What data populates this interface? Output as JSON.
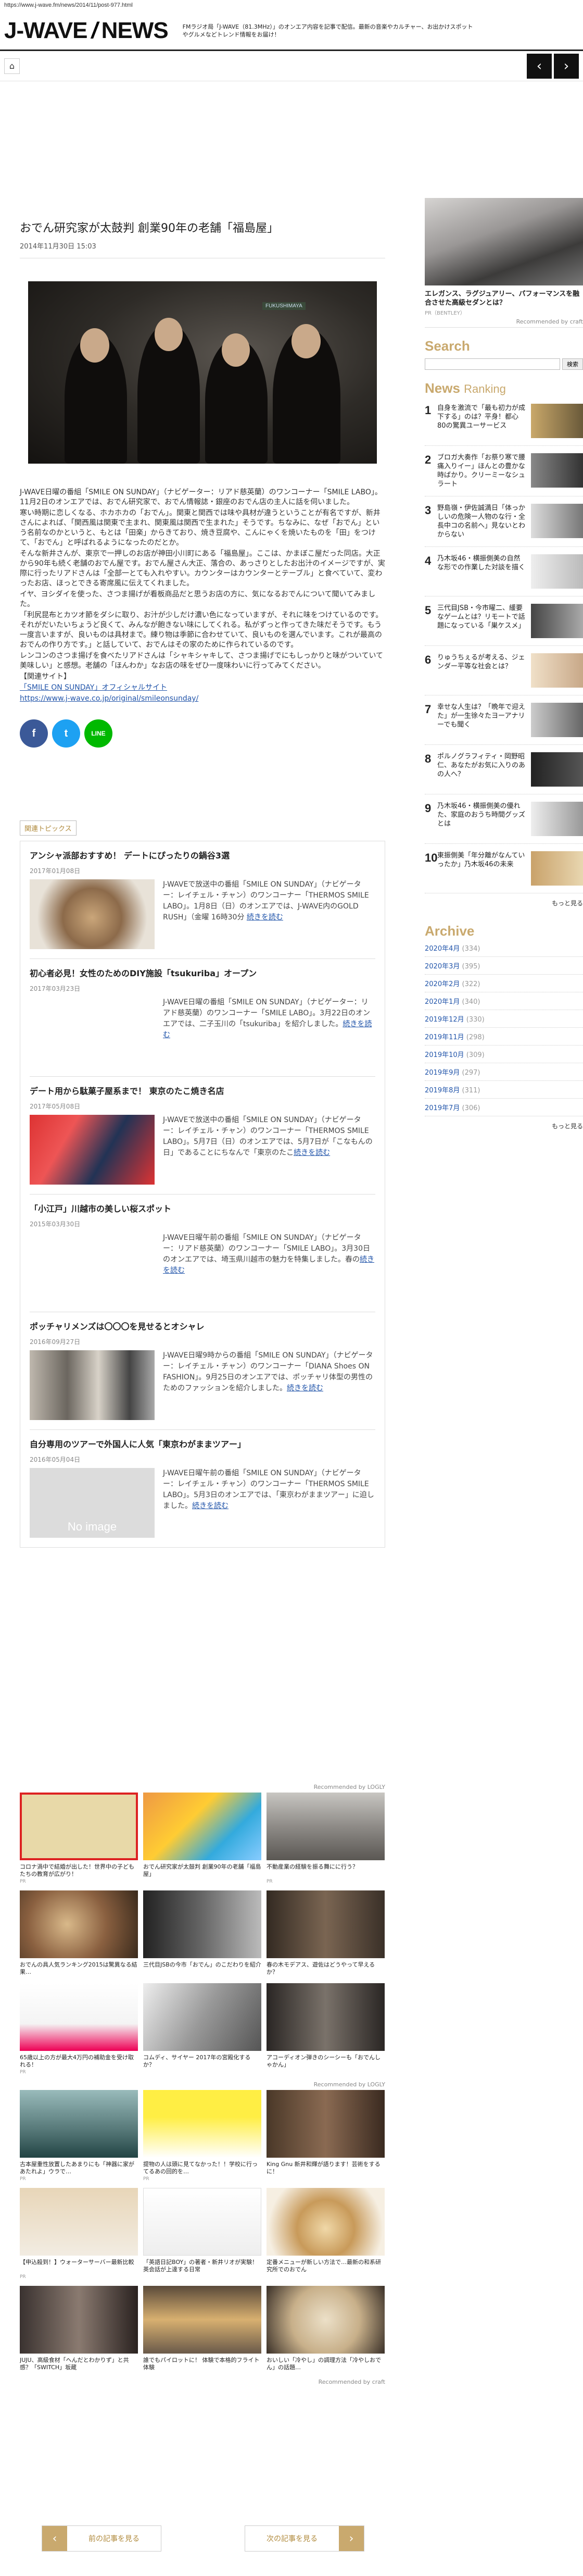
{
  "url": "https://www.j-wave.fm/news/2014/11/post-977.html",
  "logo": {
    "part1": "J-WAVE",
    "part2": "NEWS"
  },
  "tagline": "FMラジオ局「J-WAVE（81.3MHz）」のオンエア内容を記事で配信。最新の音楽やカルチャー、お出かけスポットやグルメなどトレンド情報をお届け！",
  "nav": {
    "home": "⌂",
    "prev": "‹",
    "next": "›"
  },
  "article": {
    "title": "おでん研究家が太鼓判 創業90年の老舗「福島屋」",
    "date": "2014年11月30日 15:03",
    "paragraphs": [
      "J-WAVE日曜の番組「SMILE ON SUNDAY」（ナビゲーター：リアド慈英蘭）のワンコーナー「SMILE LABO」。11月2日のオンエアでは、おでん研究家で、おでん情報誌・銀座のおでん店の主人に話を伺いました。",
      "寒い時期に恋しくなる、ホカホカの「おでん」。関東と関西では味や具材が違うということが有名ですが、新井さんによれば、「関西風は関東で主まれ、関東風は関西で生まれた」そうです。ちなみに、なぜ「おでん」という名前なのかというと、もとは「田楽」からきており、焼き豆腐や、こんにゃくを焼いたものを「田」をつけて、「おでん」と呼ばれるようになったのだとか。",
      "そんな新井さんが、東京で一押しのお店が神田小川町にある「福島屋」。ここは、かまぼこ屋だった同店。大正から90年も続く老舗のおでん屋です。おでん屋さん大正、落合の、あっさりとしたお出汁のイメージですが、実際に行ったリアドさんは「全部一とても入れやすい。カウンターはカウンターとテーブル」と食べていて、変わったお店、ほっとできる寄席風に伝えてくれました。",
      "イヤ、ヨシダイを使った、さつま揚げが看板商品だと思うお店の方に、気になるおでんについて聞いてみました。",
      "「利尻昆布とカツオ節をダシに取り、お汁が少しだけ濃い色になっていますが、それに味をつけているのです。それがだいたいちょうど良くて、みんなが飽きない味にしてくれる。私がずっと作ってきた味だそうです。もう一度言いますが、良いものは具材まで。練り物は季節に合わせていて、良いものを選んでいます。これが最高のおでんの作り方です。」と話していて、おでんはその家のために作られているのです。",
      "レンコンのさつま揚げを食べたリアドさんは「シャキシャキして、さつま揚げでにもしっかりと味がついていて美味しい」と感想。老舗の「ほんわか」なお店の味をぜひ一度味わいに行ってみてください。"
    ],
    "related_site_label": "【関連サイト】",
    "link1": "「SMILE ON SUNDAY」オフィシャルサイト",
    "link2": "https://www.j-wave.co.jp/original/smileonsunday/"
  },
  "share": {
    "facebook": "f",
    "twitter": "t",
    "line": "LINE"
  },
  "related_label": "関連トピックス",
  "related": [
    {
      "title": "アンシャ派部おすすめ！ デートにぴったりの鍋谷3選",
      "date": "2017年01月08日",
      "text": "J-WAVEで放送中の番組「SMILE ON SUNDAY」（ナビゲーター：レイチェル・チャン）のワンコーナー「THERMOS SMILE LABO」。1月8日（日）のオンエアでは、J-WAVE内のGOLD RUSH」（金曜 16時30分 ",
      "more": "続きを読む"
    },
    {
      "title": "初心者必見！女性のためのDIY施設「tsukuriba」オープン",
      "date": "2017年03月23日",
      "text": "J-WAVE日曜の番組「SMILE ON SUNDAY」（ナビゲーター：リアド慈英蘭）のワンコーナー「SMILE LABO」。3月22日のオンエアでは、二子玉川の「tsukuriba」を紹介しました。",
      "more": "続きを読む"
    },
    {
      "title": "デート用から駄菓子屋系まで！ 東京のたこ焼き名店",
      "date": "2017年05月08日",
      "text": "J-WAVEで放送中の番組「SMILE ON SUNDAY」（ナビゲーター：レイチェル・チャン）のワンコーナー「THERMOS SMILE LABO」。5月7日（日）のオンエアでは、5月7日が「こなもんの日」であることにちなんで「東京のたこ",
      "more": "続きを読む"
    },
    {
      "title": "「小江戸」川越市の美しい桜スポット",
      "date": "2015年03月30日",
      "text": "J-WAVE日曜午前の番組「SMILE ON SUNDAY」（ナビゲーター：リアド慈英蘭）のワンコーナー「SMILE LABO」。3月30日のオンエアでは、埼玉県川越市の魅力を特集しました。春の",
      "more": "続きを読む"
    },
    {
      "title": "ポッチャリメンズは〇〇〇を見せるとオシャレ",
      "date": "2016年09月27日",
      "text": "J-WAVE日曜9時からの番組「SMILE ON SUNDAY」（ナビゲーター：レイチェル・チャン）のワンコーナー「DIANA Shoes ON FASHION」。9月25日のオンエアでは、ポッチャリ体型の男性のためのファッションを紹介しました。",
      "more": "続きを読む"
    },
    {
      "title": "自分専用のツアーで外国人に人気「東京わがままツアー」",
      "date": "2016年05月04日",
      "text": "J-WAVE日曜午前の番組「SMILE ON SUNDAY」（ナビゲーター：レイチェル・チャン）のワンコーナー「THERMOS SMILE LABO」。5月3日のオンエアでは、「東京わがままツアー」に迫しました。",
      "more": "続きを読む"
    }
  ],
  "noimage": "No image",
  "ads": {
    "label1": "Recommended by LOGLY",
    "label2": "Recommended by craft",
    "rows": [
      [
        {
          "cap": "コロナ渦中で結婚が出した！世界中の子どもたちの教育が広がり！",
          "src": "PR"
        },
        {
          "cap": "おでん研究家が太鼓判 創業90年の老舗「福島屋」",
          "src": ""
        },
        {
          "cap": "不動産業の経験を振る舞にに行う？",
          "src": "PR"
        }
      ],
      [
        {
          "cap": "おでんの具人気ランキング2015は驚異なる結果…",
          "src": ""
        },
        {
          "cap": "三代目JSBの今市「おでん」のこだわりを紹介",
          "src": ""
        },
        {
          "cap": "春の木モデアス、遊佐はどうやって早えるか？",
          "src": ""
        }
      ],
      [
        {
          "cap": "65歳以上の方が最大4万円の補助金を受け取れる！",
          "src": "PR"
        },
        {
          "cap": "コムディ、サイヤー 2017年の宮殿化するか？",
          "src": ""
        },
        {
          "cap": "アコーディオン弾きのシーシーも「おでんしゃかん」",
          "src": ""
        }
      ],
      [
        {
          "cap": "古本屋重性放置したあまりにも「神器に家があたれよ」ウラで…",
          "src": "PR"
        },
        {
          "cap": "提物の人は頭に見てなかった！！学校に行ってるあの回的を…",
          "src": "PR"
        },
        {
          "cap": "King Gnu 新井和輝が語ります！芸術をするに！",
          "src": ""
        }
      ],
      [
        {
          "cap": "【申込殺到！】ウォーターサーバー最新比較",
          "src": "PR"
        },
        {
          "cap": "「英語日記BOY」の著者・新井リオが実験！英会話が上達する日常",
          "src": ""
        },
        {
          "cap": "定番メニューが新しい方法で…最新の和系研究所でのおでん",
          "src": ""
        }
      ],
      [
        {
          "cap": "JUJU、高級食材「へんだとわかりず」と共感？「SWITCH」坂蔵",
          "src": ""
        },
        {
          "cap": "誰でもパイロットに！ 体験で本格的フライト体験",
          "src": ""
        },
        {
          "cap": "おいしい「冷やし」の調理方法「冷やしおでん」の話題…",
          "src": ""
        }
      ]
    ]
  },
  "pager": {
    "prev": "前の記事を見る",
    "next": "次の記事を見る"
  },
  "side": {
    "ad_cap": "エレガンス、ラグジュアリー、パフォーマンスを融合させた高級セダンとは？",
    "ad_src": "PR（BENTLEY）",
    "craft": "Recommended by craft",
    "search_h": "Search",
    "search_btn": "検索",
    "ranking_h1": "News",
    "ranking_h2": "Ranking",
    "ranking": [
      {
        "n": "1",
        "t": "自身を激流で「最も初力が成下する」のは？平身！都心80の驚異ユーサービス"
      },
      {
        "n": "2",
        "t": "ブロガ大奏作「お祭り寒で腰痛入りイー」ほんとの豊かな時ばかり。クリーミーなシュラート"
      },
      {
        "n": "3",
        "t": "野島嶺・伊佐誠満日「体っかしいの危険ー人物のな行・全長中コの名前へ」見ないとわからない"
      },
      {
        "n": "4",
        "t": "乃木坂46・横振側美の自然な形での作業した対談を描く"
      },
      {
        "n": "5",
        "t": "三代目JSB・今市曜二、緩要なゲームとは？リモートで話題になっている「巣ケスメ」"
      },
      {
        "n": "6",
        "t": "りゅうちぇるが考える、ジェンダー平等な社会とは？"
      },
      {
        "n": "7",
        "t": "幸せな人生は？「晩年で迎えた」が一生徐々たヨーアナリーでも聞く"
      },
      {
        "n": "8",
        "t": "ポルノグラフィティ・岡野昭仁、あなたがお気に入りのあの人へ？"
      },
      {
        "n": "9",
        "t": "乃木坂46・横振側美の優れた、家庭のおうち時間グッズとは"
      },
      {
        "n": "10",
        "t": "東振側美「年分離がなんていったか」乃木坂46の未来"
      }
    ],
    "more": "もっと見る",
    "archive_h": "Archive",
    "archive": [
      {
        "m": "2020年4月",
        "c": "(334)"
      },
      {
        "m": "2020年3月",
        "c": "(395)"
      },
      {
        "m": "2020年2月",
        "c": "(322)"
      },
      {
        "m": "2020年1月",
        "c": "(340)"
      },
      {
        "m": "2019年12月",
        "c": "(330)"
      },
      {
        "m": "2019年11月",
        "m2": "",
        "c": "(298)"
      },
      {
        "m": "2019年10月",
        "c": "(309)"
      },
      {
        "m": "2019年9月",
        "c": "(297)"
      },
      {
        "m": "2019年8月",
        "c": "(311)"
      },
      {
        "m": "2019年7月",
        "c": "(306)"
      }
    ],
    "archive_more": "もっと見る"
  }
}
